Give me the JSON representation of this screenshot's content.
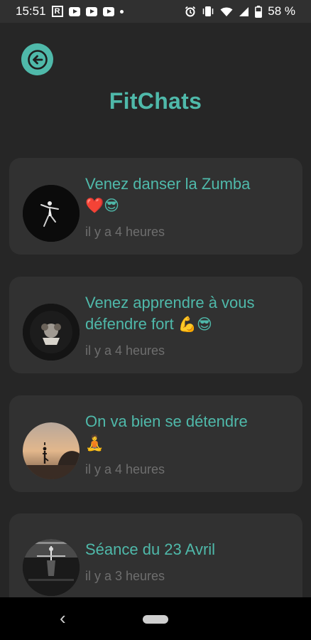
{
  "status_bar": {
    "time": "15:51",
    "battery": "58 %",
    "left_icons": [
      "r-app-icon",
      "youtube-icon",
      "youtube-icon",
      "youtube-icon",
      "dot-icon"
    ],
    "right_icons": [
      "alarm-icon",
      "vibrate-icon",
      "wifi-icon",
      "signal-icon",
      "battery-icon"
    ]
  },
  "header": {
    "back_icon": "arrow-left-icon",
    "title": "FitChats"
  },
  "chats": [
    {
      "title": "Venez danser la Zumba",
      "emoji": "❤️😎",
      "time": "il y a 4 heures",
      "avatar": "dancer-photo"
    },
    {
      "title": "Venez apprendre à vous défendre fort",
      "emoji": "💪😎",
      "time": "il y a 4 heures",
      "avatar": "boxing-photo"
    },
    {
      "title": "On va bien se détendre",
      "emoji": "🧘",
      "time": "il y a 4 heures",
      "avatar": "yoga-sunset-photo"
    },
    {
      "title": "Séance du 23 Avril",
      "emoji": "",
      "time": "il y a 3 heures",
      "avatar": "gym-photo"
    }
  ],
  "nav": {
    "back_symbol": "‹",
    "colors": {
      "accent": "#4fb9aa",
      "background": "#262626",
      "card": "#313131"
    }
  }
}
